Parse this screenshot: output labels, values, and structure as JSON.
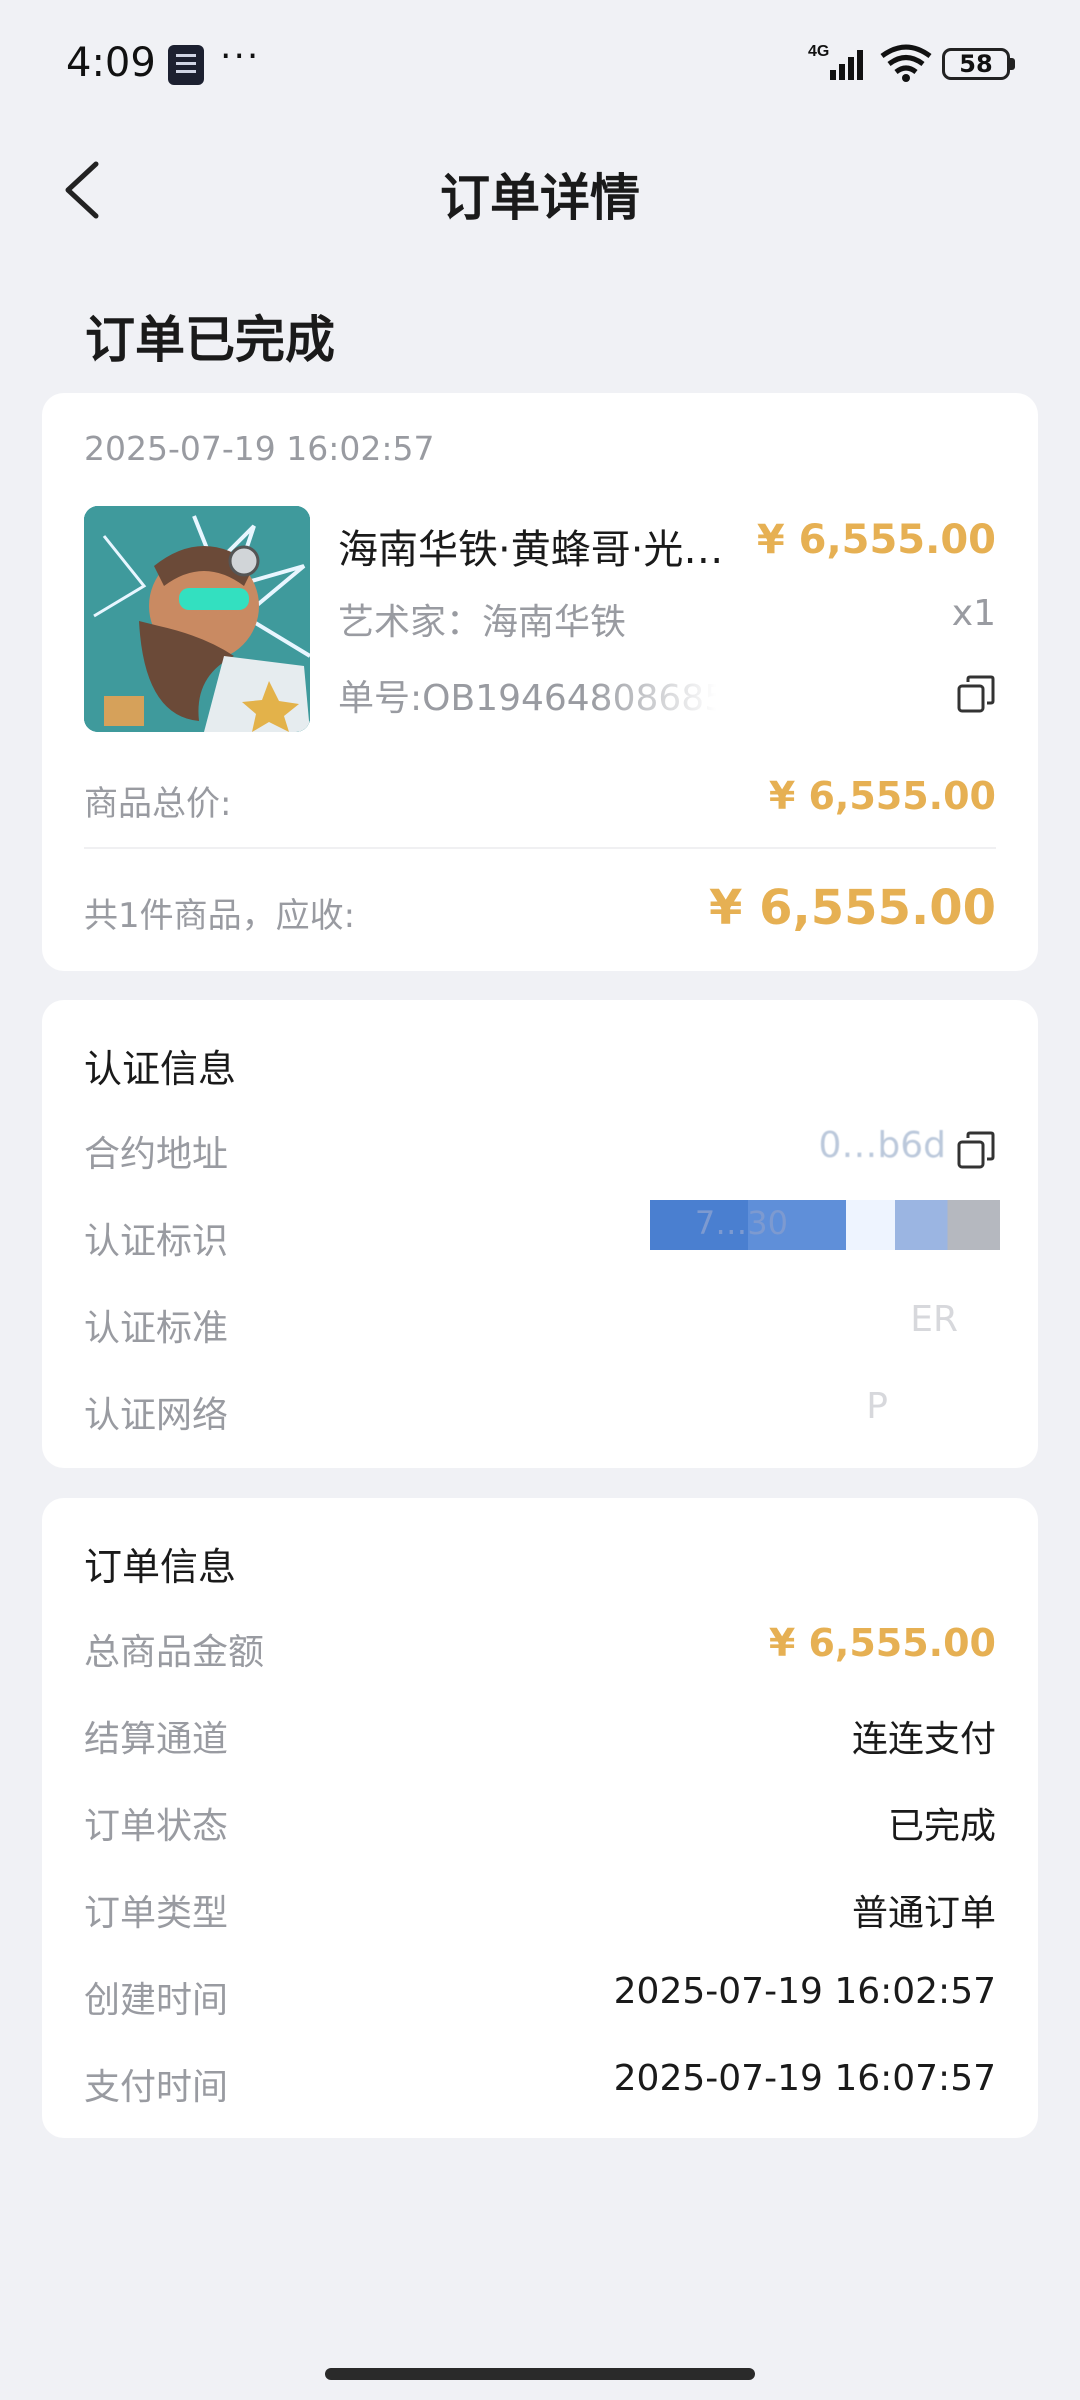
{
  "status_bar": {
    "time": "4:09",
    "dots": "···",
    "network": "4G",
    "battery": "58"
  },
  "nav": {
    "title": "订单详情",
    "back_icon": "chevron-left-icon"
  },
  "order_status": "订单已完成",
  "product_card": {
    "created_at": "2025-07-19 16:02:57",
    "name": "海南华铁·黄蜂哥·光…",
    "price": "¥ 6,555.00",
    "artist": "艺术家：海南华铁",
    "qty": "x1",
    "order_no": "单号:OB19464808685",
    "subtotal_label": "商品总价:",
    "subtotal_value": "¥ 6,555.00",
    "total_label": "共1件商品，应收:",
    "total_value": "¥ 6,555.00"
  },
  "cert_info": {
    "title": "认证信息",
    "rows": [
      {
        "label": "合约地址",
        "value": "0…b6d"
      },
      {
        "label": "认证标识",
        "value": "7…30"
      },
      {
        "label": "认证标准",
        "value": "ER"
      },
      {
        "label": "认证网络",
        "value": "P"
      }
    ]
  },
  "order_info": {
    "title": "订单信息",
    "rows": [
      {
        "label": "总商品金额",
        "value": "¥ 6,555.00"
      },
      {
        "label": "结算通道",
        "value": "连连支付"
      },
      {
        "label": "订单状态",
        "value": "已完成"
      },
      {
        "label": "订单类型",
        "value": "普通订单"
      },
      {
        "label": "创建时间",
        "value": "2025-07-19 16:02:57"
      },
      {
        "label": "支付时间",
        "value": "2025-07-19 16:07:57"
      }
    ]
  },
  "colors": {
    "accent_price": "#e6b053",
    "background": "#f0f1f5",
    "card": "#ffffff",
    "muted_text": "#999ba1"
  }
}
